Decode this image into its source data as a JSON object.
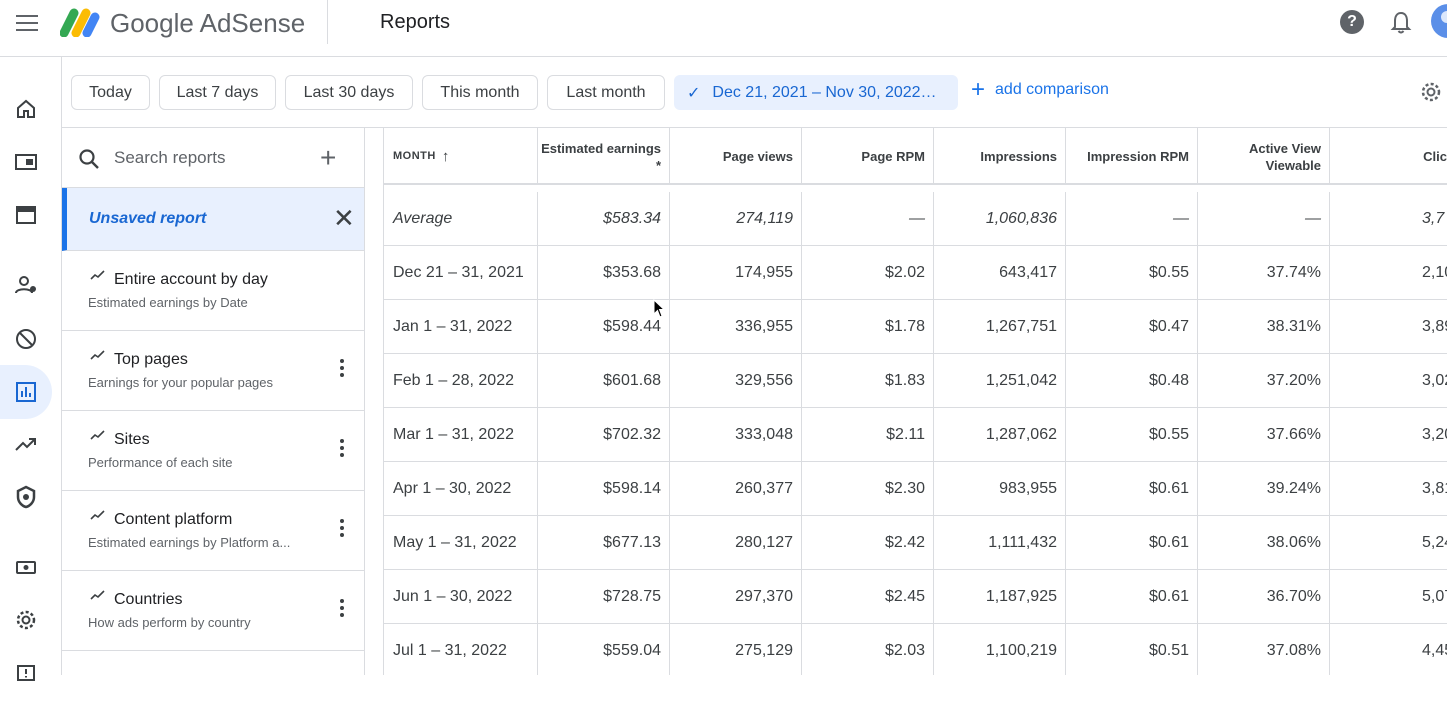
{
  "header": {
    "brand": "Google AdSense",
    "page_title": "Reports",
    "help_label": "?"
  },
  "nav_icons": [
    "home-icon",
    "ad-unit-icon",
    "sites-icon",
    "account-icon",
    "block-icon",
    "reports-icon",
    "trending-icon",
    "privacy-shield-icon",
    "payments-icon",
    "settings-icon",
    "feedback-icon"
  ],
  "filters": {
    "chips": [
      "Today",
      "Last 7 days",
      "Last 30 days",
      "This month",
      "Last month"
    ],
    "selected_range": "Dec 21, 2021 – Nov 30, 2022…",
    "add_comparison": "add comparison"
  },
  "reports_panel": {
    "search_placeholder": "Search reports",
    "unsaved_label": "Unsaved report",
    "items": [
      {
        "title": "Entire account by day",
        "subtitle": "Estimated earnings by Date"
      },
      {
        "title": "Top pages",
        "subtitle": "Earnings for your popular pages"
      },
      {
        "title": "Sites",
        "subtitle": "Performance of each site"
      },
      {
        "title": "Content platform",
        "subtitle": "Estimated earnings by Platform a..."
      },
      {
        "title": "Countries",
        "subtitle": "How ads perform by country"
      }
    ]
  },
  "table": {
    "columns": [
      "MONTH",
      "Estimated earnings *",
      "Page views",
      "Page RPM",
      "Impressions",
      "Impression RPM",
      "Active View Viewable",
      "Clic"
    ],
    "sort_indicator": "↑",
    "average_row": [
      "Average",
      "$583.34",
      "274,119",
      "—",
      "1,060,836",
      "—",
      "—",
      "3,7"
    ],
    "rows": [
      [
        "Dec 21 – 31, 2021",
        "$353.68",
        "174,955",
        "$2.02",
        "643,417",
        "$0.55",
        "37.74%",
        "2,10"
      ],
      [
        "Jan 1 – 31, 2022",
        "$598.44",
        "336,955",
        "$1.78",
        "1,267,751",
        "$0.47",
        "38.31%",
        "3,89"
      ],
      [
        "Feb 1 – 28, 2022",
        "$601.68",
        "329,556",
        "$1.83",
        "1,251,042",
        "$0.48",
        "37.20%",
        "3,02"
      ],
      [
        "Mar 1 – 31, 2022",
        "$702.32",
        "333,048",
        "$2.11",
        "1,287,062",
        "$0.55",
        "37.66%",
        "3,20"
      ],
      [
        "Apr 1 – 30, 2022",
        "$598.14",
        "260,377",
        "$2.30",
        "983,955",
        "$0.61",
        "39.24%",
        "3,81"
      ],
      [
        "May 1 – 31, 2022",
        "$677.13",
        "280,127",
        "$2.42",
        "1,111,432",
        "$0.61",
        "38.06%",
        "5,24"
      ],
      [
        "Jun 1 – 30, 2022",
        "$728.75",
        "297,370",
        "$2.45",
        "1,187,925",
        "$0.61",
        "36.70%",
        "5,07"
      ],
      [
        "Jul 1 – 31, 2022",
        "$559.04",
        "275,129",
        "$2.03",
        "1,100,219",
        "$0.51",
        "37.08%",
        "4,45"
      ]
    ]
  },
  "colors": {
    "accent": "#1a73e8",
    "selected_bg": "#e8f0fe",
    "border": "#dadce0"
  }
}
